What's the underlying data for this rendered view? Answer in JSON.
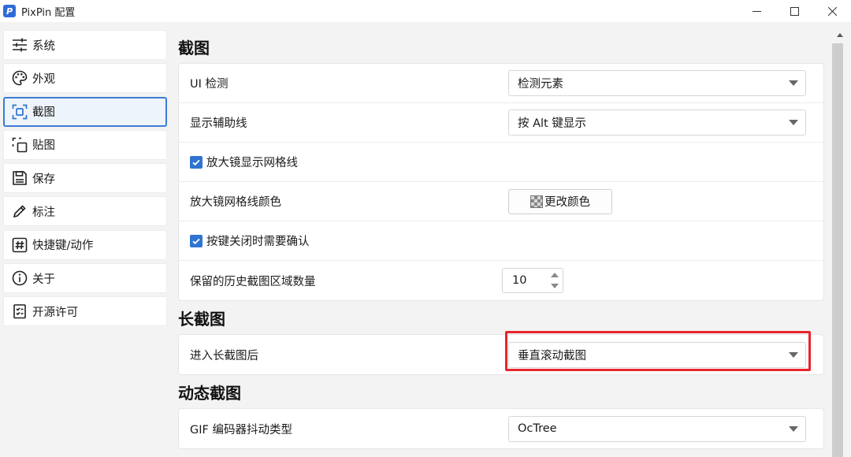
{
  "window": {
    "title": "PixPin 配置",
    "logo_letter": "P"
  },
  "sidebar": {
    "items": [
      {
        "label": "系统",
        "icon": "sliders-icon",
        "active": false
      },
      {
        "label": "外观",
        "icon": "palette-icon",
        "active": false
      },
      {
        "label": "截图",
        "icon": "screenshot-icon",
        "active": true
      },
      {
        "label": "贴图",
        "icon": "pin-image-icon",
        "active": false
      },
      {
        "label": "保存",
        "icon": "save-icon",
        "active": false
      },
      {
        "label": "标注",
        "icon": "pen-icon",
        "active": false
      },
      {
        "label": "快捷键/动作",
        "icon": "hash-key-icon",
        "active": false
      },
      {
        "label": "关于",
        "icon": "info-icon",
        "active": false
      },
      {
        "label": "开源许可",
        "icon": "license-icon",
        "active": false
      }
    ]
  },
  "sections": {
    "screenshot": {
      "title": "截图",
      "ui_detect_label": "UI 检测",
      "ui_detect_value": "检测元素",
      "guide_lines_label": "显示辅助线",
      "guide_lines_value": "按 Alt 键显示",
      "magnifier_grid_label": "放大镜显示网格线",
      "magnifier_grid_checked": true,
      "grid_color_label": "放大镜网格线颜色",
      "grid_color_button": "更改颜色",
      "confirm_close_label": "按键关闭时需要确认",
      "confirm_close_checked": true,
      "history_count_label": "保留的历史截图区域数量",
      "history_count_value": "10"
    },
    "long_screenshot": {
      "title": "长截图",
      "after_enter_label": "进入长截图后",
      "after_enter_value": "垂直滚动截图"
    },
    "gif": {
      "title": "动态截图",
      "dither_label": "GIF 编码器抖动类型",
      "dither_value": "OcTree"
    }
  },
  "colors": {
    "accent": "#2f74d0",
    "active_border": "#3c7bd4",
    "highlight_box": "#e8242c"
  }
}
